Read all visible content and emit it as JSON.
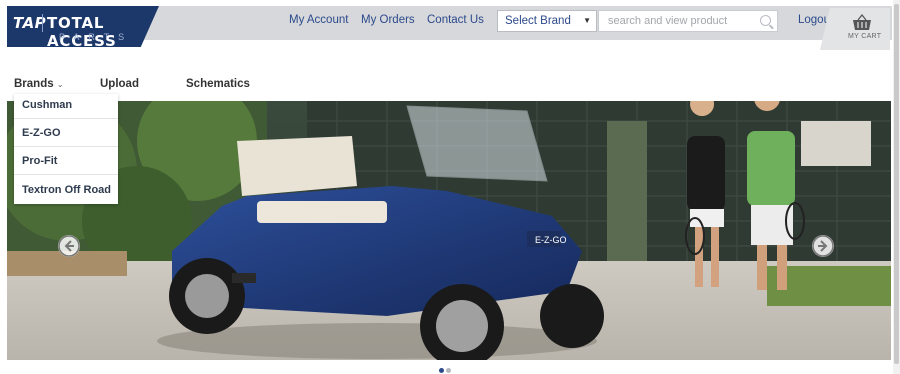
{
  "header": {
    "logo": {
      "mark": "TAP",
      "name": "TOTAL ACCESS",
      "sub": "PARTS"
    },
    "links": [
      "My Account",
      "My Orders",
      "Contact Us"
    ],
    "brand_select": {
      "value": "Select Brand"
    },
    "search": {
      "placeholder": "search and view product"
    },
    "logout": "Logout",
    "cart_label": "MY CART"
  },
  "menu": {
    "brands": "Brands",
    "upload": "Upload",
    "schematics": "Schematics"
  },
  "brands_dropdown": [
    "Cushman",
    "E-Z-GO",
    "Pro-Fit",
    "Textron Off Road"
  ],
  "hero": {
    "cart_badge": "E-Z-GO"
  },
  "colors": {
    "brand_navy": "#1c3769",
    "link_blue": "#2c4a8b",
    "topbar_gray": "#d6d8db",
    "cart_blue": "#1f3f8a"
  },
  "carousel": {
    "active_index": 0,
    "count": 2
  }
}
